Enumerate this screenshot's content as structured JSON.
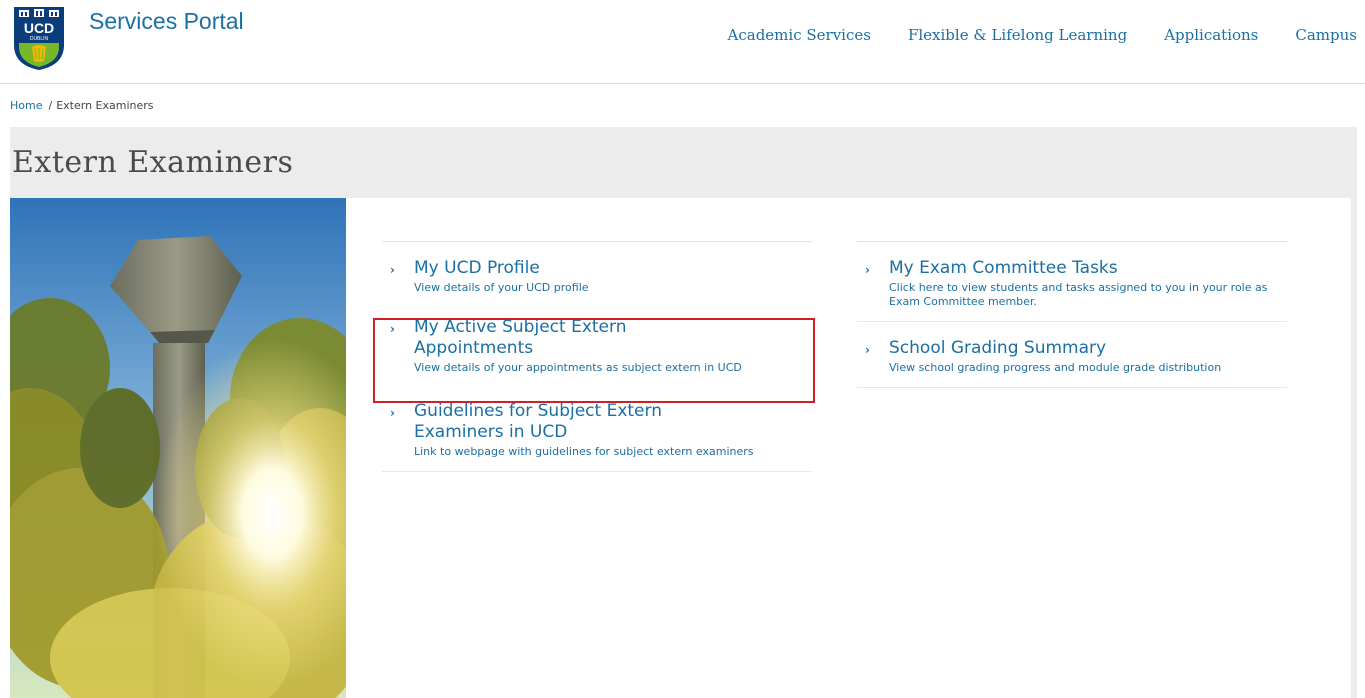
{
  "header": {
    "logo_text": "UCD",
    "logo_subtext": "DUBLIN",
    "title": "Services Portal",
    "nav": [
      {
        "label": "Academic Services"
      },
      {
        "label": "Flexible & Lifelong Learning"
      },
      {
        "label": "Applications"
      },
      {
        "label": "Campus"
      }
    ]
  },
  "breadcrumb": {
    "home": "Home",
    "separator": "/",
    "current": "Extern Examiners"
  },
  "page": {
    "title": "Extern Examiners"
  },
  "links": {
    "left": [
      {
        "title": "My UCD Profile",
        "description": "View details of your UCD profile"
      },
      {
        "title": "My Active Subject Extern Appointments",
        "description": "View details of your appointments as subject extern in UCD",
        "highlighted": true
      },
      {
        "title": "Guidelines for Subject Extern Examiners in UCD",
        "description": "Link to webpage with guidelines for subject extern examiners"
      }
    ],
    "right": [
      {
        "title": "My Exam Committee Tasks",
        "description": "Click here to view students and tasks assigned to you in your role as Exam Committee member."
      },
      {
        "title": "School Grading Summary",
        "description": "View school grading progress and module grade distribution"
      }
    ]
  },
  "icons": {
    "chevron": "chevron-right-icon",
    "chevron_glyph": "›"
  },
  "colors": {
    "link": "#1a6fa3",
    "highlight": "#d01f25",
    "band": "#ececec",
    "logo_blue": "#0b3d7c",
    "logo_gold": "#f2b705",
    "logo_green": "#76b82a"
  }
}
